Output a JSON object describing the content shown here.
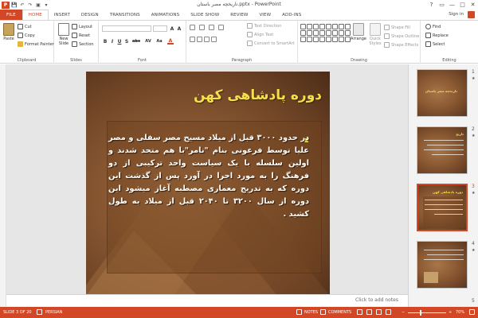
{
  "app": {
    "logo_letter": "P",
    "window_title": "تاریخچه مصر باستان.pptx - PowerPoint",
    "window_controls": {
      "help": "?",
      "restore": "▭",
      "minimize": "—",
      "maximize": "□",
      "close": "✕"
    },
    "quick_access": {
      "save": "💾",
      "undo": "↶",
      "redo": "↷",
      "start": "▣",
      "more": "▾"
    }
  },
  "tabs": [
    {
      "id": "file",
      "label": "FILE"
    },
    {
      "id": "home",
      "label": "HOME"
    },
    {
      "id": "insert",
      "label": "INSERT"
    },
    {
      "id": "design",
      "label": "DESIGN"
    },
    {
      "id": "transitions",
      "label": "TRANSITIONS"
    },
    {
      "id": "animations",
      "label": "ANIMATIONS"
    },
    {
      "id": "slideshow",
      "label": "SLIDE SHOW"
    },
    {
      "id": "review",
      "label": "REVIEW"
    },
    {
      "id": "view",
      "label": "VIEW"
    },
    {
      "id": "addins",
      "label": "ADD-INS"
    }
  ],
  "signin": "Sign in",
  "ribbon": {
    "clipboard": {
      "label": "Clipboard",
      "paste": "Paste",
      "cut": "Cut",
      "copy": "Copy",
      "format_painter": "Format Painter"
    },
    "slides": {
      "label": "Slides",
      "new_slide": "New",
      "new_slide2": "Slide",
      "layout": "Layout",
      "reset": "Reset",
      "section": "Section"
    },
    "font": {
      "label": "Font",
      "bold": "B",
      "italic": "I",
      "underline": "U",
      "shadow": "S",
      "strike": "abc",
      "spacing": "AV",
      "case": "Aa",
      "color": "A"
    },
    "paragraph": {
      "label": "Paragraph",
      "text_direction": "Text Direction",
      "align_text": "Align Text",
      "convert_smartart": "Convert to SmartArt"
    },
    "drawing": {
      "label": "Drawing",
      "arrange": "Arrange",
      "quick_styles": "Quick",
      "quick_styles2": "Styles",
      "shape_fill": "Shape Fill",
      "shape_outline": "Shape Outline",
      "shape_effects": "Shape Effects"
    },
    "editing": {
      "label": "Editing",
      "find": "Find",
      "replace": "Replace",
      "select": "Select"
    }
  },
  "slide": {
    "title": "دوره پادشاهی کهن",
    "body": "در حدود ۳۰۰۰ قبل از میلاد مسیح مصر سفلی و مصر علیا توسط فرعونی بنام \"نامر\"با هم متحد شدند و اولین سلسله با یک سیاست واحد ترکیبی از دو فرهنگ را به مورد اجرا در آورد پس از گذشت این دوره که به تدریج معماری مصطبه آغاز میشود این دوره از سال ۳۲۰۰ تا ۲۰۴۰ قبل از میلاد به طول کشید ."
  },
  "notes_hint": "Click to add notes",
  "thumbnails": [
    {
      "number": "1",
      "title": "تاریخچه مصر باستان",
      "selected": false
    },
    {
      "number": "2",
      "title": "تاریخ",
      "selected": false
    },
    {
      "number": "3",
      "title": "دوره پادشاهی کهن",
      "selected": true
    },
    {
      "number": "4",
      "title": "",
      "selected": false
    },
    {
      "number": "5",
      "title": "",
      "selected": false
    }
  ],
  "thumb_star": "★",
  "status": {
    "slide_of": "SLIDE 3 OF 20",
    "language": "PERSIAN",
    "notes": "NOTES",
    "comments": "COMMENTS",
    "zoom": "70%",
    "zoom_level": 0.7,
    "minus": "−",
    "plus": "+"
  },
  "colors": {
    "accent": "#d24726",
    "title_yellow": "#f3e04b"
  }
}
